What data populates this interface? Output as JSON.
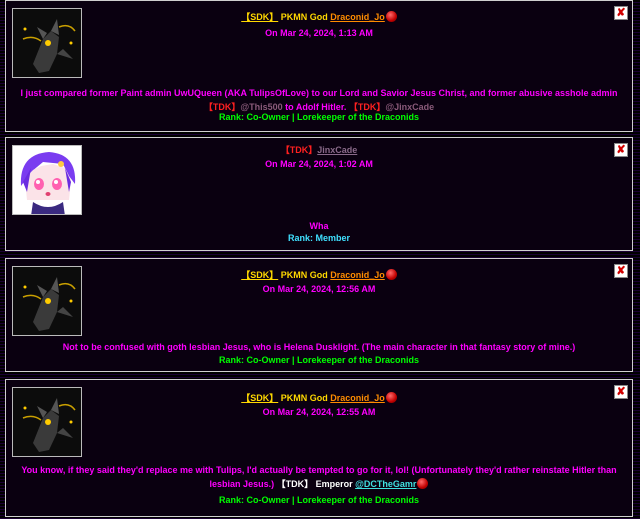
{
  "posts": [
    {
      "delete_glyph": "✘",
      "tag": "【SDK】",
      "title": "PKMN God",
      "author": "Draconid_Jo",
      "date": "On Mar 24, 2024, 1:13 AM",
      "body_text": "I just compared former Paint admin UwUQueen (AKA TulipsOfLove) to our Lord and Savior Jesus Christ, and former abusive asshole admin",
      "mention1_tag": "【TDK】",
      "mention1_name": "@This500",
      "mention_join": "to Adolf Hitler.",
      "mention2_tag": "【TDK】",
      "mention2_name": "@JinxCade",
      "rank": "Rank: Co-Owner | Lorekeeper of the Draconids"
    },
    {
      "delete_glyph": "✘",
      "tag": "【TDK】",
      "author": "JinxCade",
      "date": "On Mar 24, 2024, 1:02 AM",
      "body_text": "Wha",
      "rank": "Rank: Member"
    },
    {
      "delete_glyph": "✘",
      "tag": "【SDK】",
      "title": "PKMN God",
      "author": "Draconid_Jo",
      "date": "On Mar 24, 2024, 12:56 AM",
      "body_text": "Not to be confused with goth lesbian Jesus, who is Helena Dusklight. (The main character in that fantasy story of mine.)",
      "rank": "Rank: Co-Owner | Lorekeeper of the Draconids"
    },
    {
      "delete_glyph": "✘",
      "tag": "【SDK】",
      "title": "PKMN God",
      "author": "Draconid_Jo",
      "date": "On Mar 24, 2024, 12:55 AM",
      "body_text": "You know, if they said they'd replace me with Tulips, I'd actually be tempted to go for it, lol! (Unfortunately they'd rather reinstate Hitler than lesbian Jesus.)",
      "mention_tag": "【TDK】",
      "mention_title": "Emperor",
      "mention_name": "@DCTheGamr",
      "rank": "Rank: Co-Owner | Lorekeeper of the Draconids"
    }
  ],
  "colors": {
    "body_text": "#ff00ff",
    "rank": "#00ff00",
    "gold": "#ffd800",
    "tdk_red": "#ff2020",
    "cyan": "#40e0ff"
  }
}
